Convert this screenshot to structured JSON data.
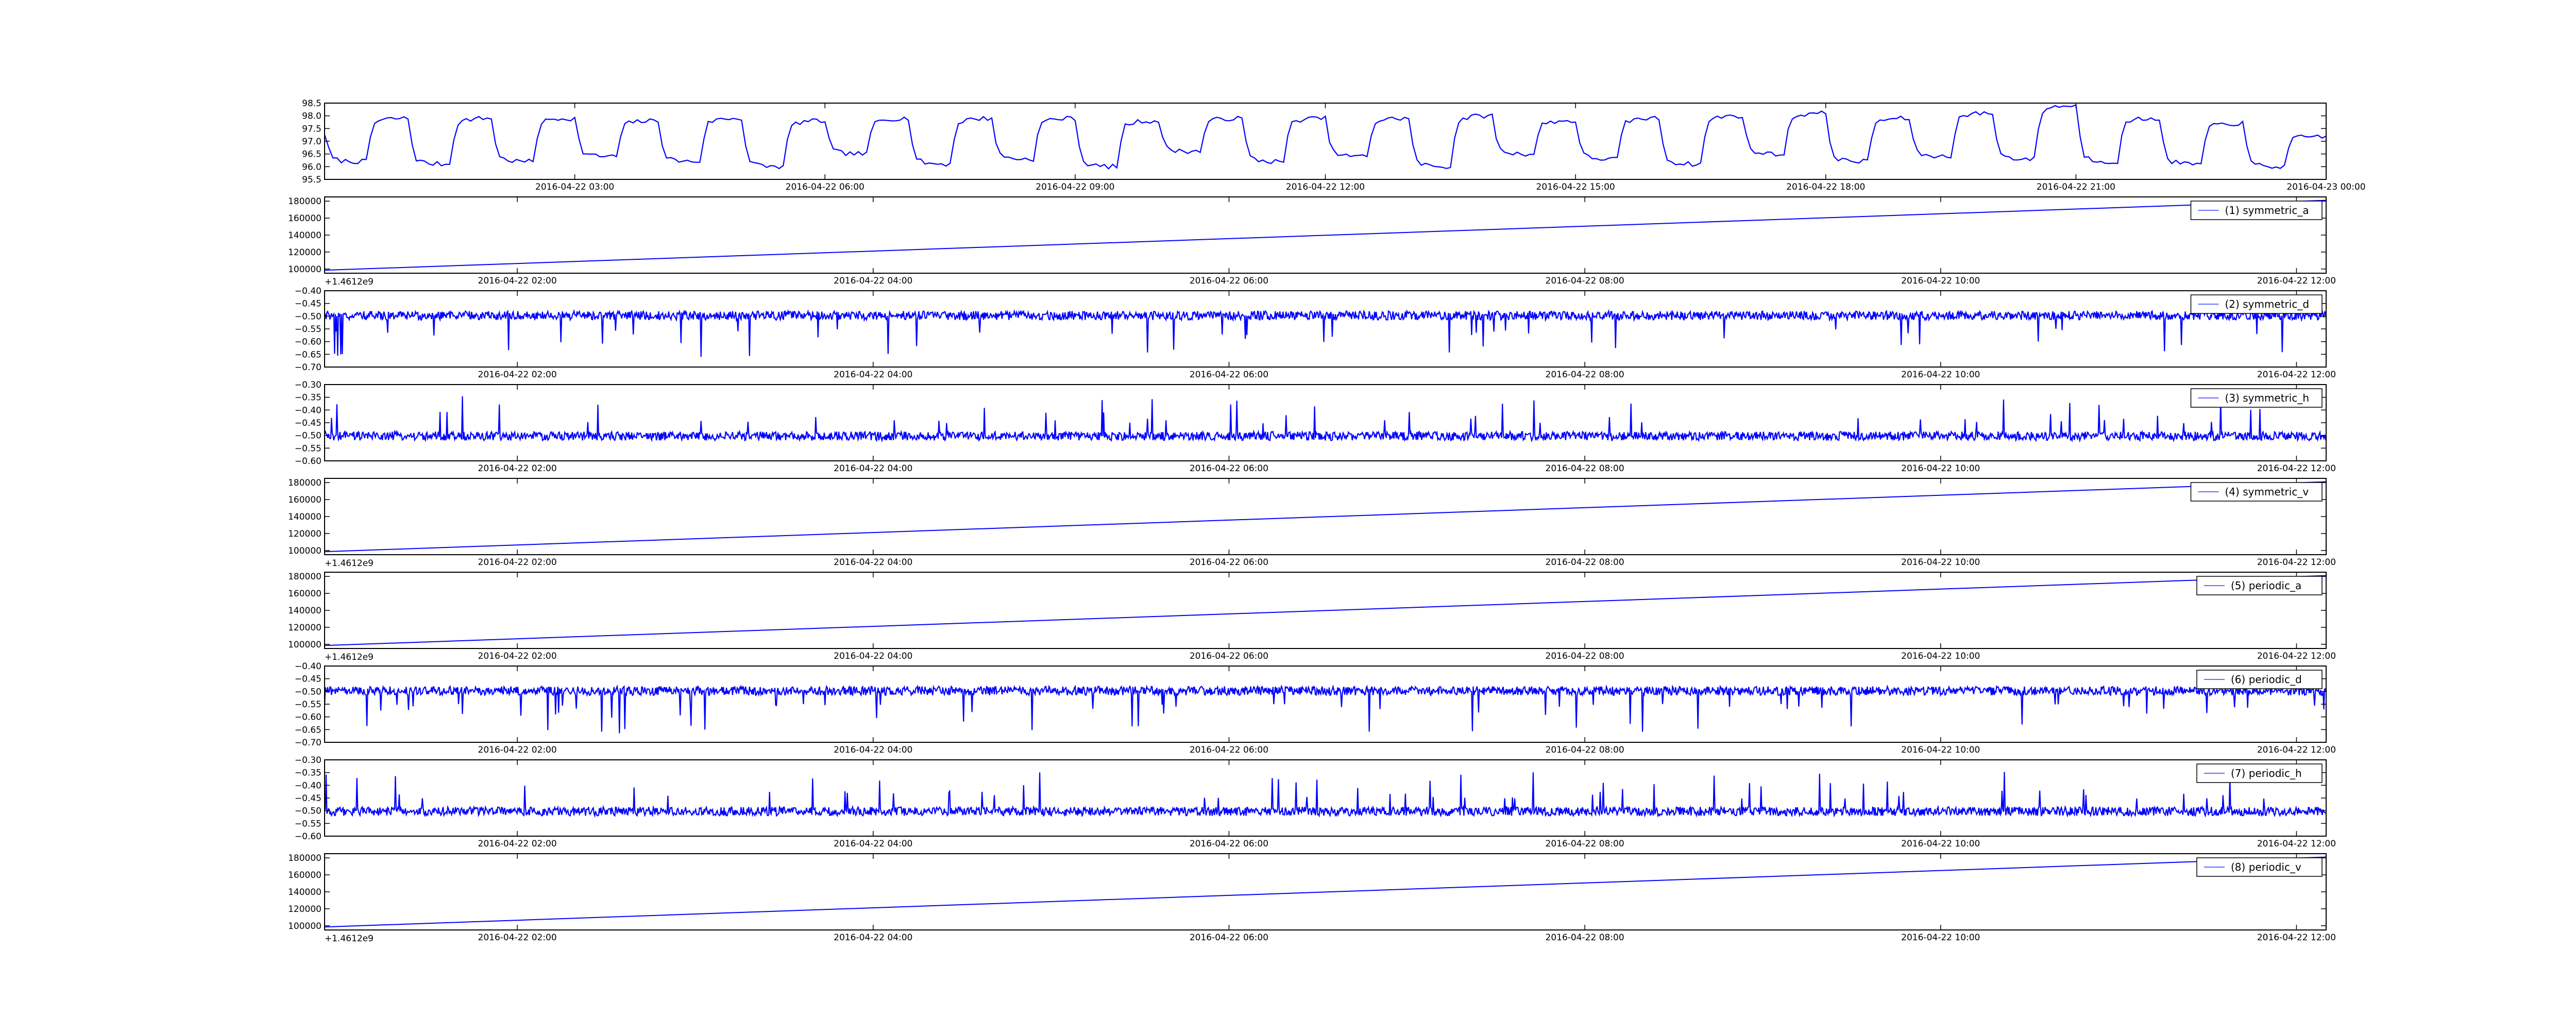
{
  "figure": {
    "background": "#ffffff",
    "line_color": "#0000ff",
    "legend_line_color": "#6b6bff"
  },
  "chart_data": [
    {
      "type": "line",
      "title": "",
      "xlabel": "",
      "ylabel": "",
      "x_range": [
        "2016-04-22 00:00",
        "2016-04-23 00:00"
      ],
      "ylim": [
        95.5,
        98.5
      ],
      "yticks": [
        "95.5",
        "96.0",
        "96.5",
        "97.0",
        "97.5",
        "98.0",
        "98.5"
      ],
      "xticks": [
        "2016-04-22 03:00",
        "2016-04-22 06:00",
        "2016-04-22 09:00",
        "2016-04-22 12:00",
        "2016-04-22 15:00",
        "2016-04-22 18:00",
        "2016-04-22 21:00",
        "2016-04-23 00:00"
      ],
      "offset_label": "",
      "legend": "",
      "series": [
        {
          "pattern": "square_wave",
          "x": [
            0,
            0.5,
            1,
            1.5,
            2,
            2.5,
            3,
            3.5,
            4,
            4.5,
            5,
            5.5,
            6,
            6.5,
            7,
            7.5,
            8,
            8.5,
            9,
            9.5,
            10,
            10.5,
            11,
            11.5,
            12,
            12.5,
            13,
            13.5,
            14,
            14.5,
            15,
            15.5,
            16,
            16.5,
            17,
            17.5,
            18,
            18.5,
            19,
            19.5,
            20,
            20.5,
            21,
            21.5,
            22,
            22.5,
            23,
            23.5,
            24
          ],
          "values": [
            97.3,
            96.2,
            97.9,
            96.1,
            97.9,
            96.2,
            97.9,
            96.4,
            97.8,
            96.2,
            97.9,
            96.0,
            97.8,
            96.5,
            97.9,
            96.1,
            97.9,
            96.3,
            97.9,
            96.0,
            97.8,
            96.6,
            97.9,
            96.2,
            97.9,
            96.4,
            97.9,
            96.0,
            98.0,
            96.5,
            97.8,
            96.3,
            97.9,
            96.1,
            98.0,
            96.5,
            98.1,
            96.2,
            97.9,
            96.4,
            98.1,
            96.3,
            98.4,
            96.2,
            97.9,
            96.1,
            97.7,
            96.0,
            97.2
          ]
        }
      ]
    },
    {
      "type": "line",
      "title": "",
      "xlabel": "",
      "ylabel": "",
      "x_range": [
        "2016-04-22 00:55",
        "2016-04-22 12:10"
      ],
      "ylim": [
        95000,
        185000
      ],
      "yticks": [
        "100000",
        "120000",
        "140000",
        "160000",
        "180000"
      ],
      "xticks": [
        "2016-04-22 02:00",
        "2016-04-22 04:00",
        "2016-04-22 06:00",
        "2016-04-22 08:00",
        "2016-04-22 10:00",
        "2016-04-22 12:00"
      ],
      "offset_label": "+1.4612e9",
      "legend": "top-right",
      "series": [
        {
          "name": "(1) symmetric_a",
          "pattern": "linear",
          "x": [
            "2016-04-22 00:55",
            "2016-04-22 12:10"
          ],
          "values": [
            98500,
            181000
          ]
        }
      ]
    },
    {
      "type": "line",
      "title": "",
      "xlabel": "",
      "ylabel": "",
      "x_range": [
        "2016-04-22 00:55",
        "2016-04-22 12:10"
      ],
      "ylim": [
        -0.7,
        -0.4
      ],
      "yticks": [
        "−0.70",
        "−0.65",
        "−0.60",
        "−0.55",
        "−0.50",
        "−0.45",
        "−0.40"
      ],
      "xticks": [
        "2016-04-22 02:00",
        "2016-04-22 04:00",
        "2016-04-22 06:00",
        "2016-04-22 08:00",
        "2016-04-22 10:00",
        "2016-04-22 12:00"
      ],
      "offset_label": "",
      "legend": "top-right",
      "series": [
        {
          "name": "(2) symmetric_d",
          "pattern": "noise",
          "baseline": -0.5,
          "spread": [
            -0.515,
            -0.48
          ],
          "spikes": "down",
          "spike_extreme": -0.665
        }
      ]
    },
    {
      "type": "line",
      "title": "",
      "xlabel": "",
      "ylabel": "",
      "x_range": [
        "2016-04-22 00:55",
        "2016-04-22 12:10"
      ],
      "ylim": [
        -0.6,
        -0.3
      ],
      "yticks": [
        "−0.60",
        "−0.55",
        "−0.50",
        "−0.45",
        "−0.40",
        "−0.35",
        "−0.30"
      ],
      "xticks": [
        "2016-04-22 02:00",
        "2016-04-22 04:00",
        "2016-04-22 06:00",
        "2016-04-22 08:00",
        "2016-04-22 10:00",
        "2016-04-22 12:00"
      ],
      "offset_label": "",
      "legend": "top-right",
      "series": [
        {
          "name": "(3) symmetric_h",
          "pattern": "noise",
          "baseline": -0.5,
          "spread": [
            -0.52,
            -0.485
          ],
          "spikes": "up",
          "spike_extreme": -0.34
        }
      ]
    },
    {
      "type": "line",
      "title": "",
      "xlabel": "",
      "ylabel": "",
      "x_range": [
        "2016-04-22 00:55",
        "2016-04-22 12:10"
      ],
      "ylim": [
        95000,
        185000
      ],
      "yticks": [
        "100000",
        "120000",
        "140000",
        "160000",
        "180000"
      ],
      "xticks": [
        "2016-04-22 02:00",
        "2016-04-22 04:00",
        "2016-04-22 06:00",
        "2016-04-22 08:00",
        "2016-04-22 10:00",
        "2016-04-22 12:00"
      ],
      "offset_label": "+1.4612e9",
      "legend": "top-right",
      "series": [
        {
          "name": "(4) symmetric_v",
          "pattern": "linear",
          "x": [
            "2016-04-22 00:55",
            "2016-04-22 12:10"
          ],
          "values": [
            98500,
            181000
          ]
        }
      ]
    },
    {
      "type": "line",
      "title": "",
      "xlabel": "",
      "ylabel": "",
      "x_range": [
        "2016-04-22 00:55",
        "2016-04-22 12:10"
      ],
      "ylim": [
        95000,
        185000
      ],
      "yticks": [
        "100000",
        "120000",
        "140000",
        "160000",
        "180000"
      ],
      "xticks": [
        "2016-04-22 02:00",
        "2016-04-22 04:00",
        "2016-04-22 06:00",
        "2016-04-22 08:00",
        "2016-04-22 10:00",
        "2016-04-22 12:00"
      ],
      "offset_label": "+1.4612e9",
      "legend": "top-right",
      "series": [
        {
          "name": "(5) periodic_a",
          "pattern": "linear",
          "x": [
            "2016-04-22 00:55",
            "2016-04-22 12:10"
          ],
          "values": [
            98500,
            181000
          ]
        }
      ]
    },
    {
      "type": "line",
      "title": "",
      "xlabel": "",
      "ylabel": "",
      "x_range": [
        "2016-04-22 00:55",
        "2016-04-22 12:10"
      ],
      "ylim": [
        -0.7,
        -0.4
      ],
      "yticks": [
        "−0.70",
        "−0.65",
        "−0.60",
        "−0.55",
        "−0.50",
        "−0.45",
        "−0.40"
      ],
      "xticks": [
        "2016-04-22 02:00",
        "2016-04-22 04:00",
        "2016-04-22 06:00",
        "2016-04-22 08:00",
        "2016-04-22 10:00",
        "2016-04-22 12:00"
      ],
      "offset_label": "",
      "legend": "top-right",
      "series": [
        {
          "name": "(6) periodic_d",
          "pattern": "noise",
          "baseline": -0.5,
          "spread": [
            -0.515,
            -0.48
          ],
          "spikes": "down",
          "spike_extreme": -0.665
        }
      ]
    },
    {
      "type": "line",
      "title": "",
      "xlabel": "",
      "ylabel": "",
      "x_range": [
        "2016-04-22 00:55",
        "2016-04-22 12:10"
      ],
      "ylim": [
        -0.6,
        -0.3
      ],
      "yticks": [
        "−0.60",
        "−0.55",
        "−0.50",
        "−0.45",
        "−0.40",
        "−0.35",
        "−0.30"
      ],
      "xticks": [
        "2016-04-22 02:00",
        "2016-04-22 04:00",
        "2016-04-22 06:00",
        "2016-04-22 08:00",
        "2016-04-22 10:00",
        "2016-04-22 12:00"
      ],
      "offset_label": "",
      "legend": "top-right",
      "series": [
        {
          "name": "(7) periodic_h",
          "pattern": "noise",
          "baseline": -0.5,
          "spread": [
            -0.52,
            -0.485
          ],
          "spikes": "up",
          "spike_extreme": -0.34
        }
      ]
    },
    {
      "type": "line",
      "title": "",
      "xlabel": "",
      "ylabel": "",
      "x_range": [
        "2016-04-22 00:55",
        "2016-04-22 12:10"
      ],
      "ylim": [
        95000,
        185000
      ],
      "yticks": [
        "100000",
        "120000",
        "140000",
        "160000",
        "180000"
      ],
      "xticks": [
        "2016-04-22 02:00",
        "2016-04-22 04:00",
        "2016-04-22 06:00",
        "2016-04-22 08:00",
        "2016-04-22 10:00",
        "2016-04-22 12:00"
      ],
      "offset_label": "+1.4612e9",
      "legend": "top-right",
      "series": [
        {
          "name": "(8) periodic_v",
          "pattern": "linear",
          "x": [
            "2016-04-22 00:55",
            "2016-04-22 12:10"
          ],
          "values": [
            98500,
            181000
          ]
        }
      ]
    }
  ]
}
